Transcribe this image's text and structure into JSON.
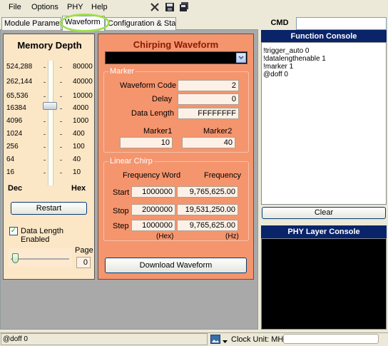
{
  "menu": {
    "items": [
      {
        "label": "File"
      },
      {
        "label": "Options"
      },
      {
        "label": "PHY"
      },
      {
        "label": "Help"
      }
    ],
    "toolbar_icons": [
      "close-icon",
      "save-icon",
      "save-all-icon"
    ]
  },
  "tabs": [
    {
      "label": "Module Parameters",
      "active": false
    },
    {
      "label": "Waveform",
      "active": true
    },
    {
      "label": "Configuration & Status",
      "active": false
    }
  ],
  "memory_depth": {
    "title": "Memory Depth",
    "dec_values": [
      "524,288",
      "262,144",
      "65,536",
      "16384",
      "4096",
      "1024",
      "256",
      "64",
      "16"
    ],
    "hex_values": [
      "80000",
      "40000",
      "10000",
      "4000",
      "1000",
      "400",
      "100",
      "40",
      "10"
    ],
    "dec_label": "Dec",
    "hex_label": "Hex",
    "slider_selected": "16384",
    "restart_label": "Restart",
    "data_length_enabled_label": "Data Length Enabled",
    "data_length_enabled": true,
    "page_label": "Page",
    "page_value": "0"
  },
  "chirp": {
    "title": "Chirping Waveform",
    "dropdown_value": "",
    "marker": {
      "group_title": "Marker",
      "waveform_code_label": "Waveform Code",
      "waveform_code": "2",
      "delay_label": "Delay",
      "delay": "0",
      "data_length_label": "Data Length",
      "data_length": "FFFFFFFF",
      "marker1_label": "Marker1",
      "marker1": "10",
      "marker2_label": "Marker2",
      "marker2": "40"
    },
    "linear": {
      "group_title": "Linear Chirp",
      "freq_word_header": "Frequency Word",
      "freq_header": "Frequency",
      "start_label": "Start",
      "start_word": "1000000",
      "start_freq": "9,765,625.00",
      "stop_label": "Stop",
      "stop_word": "2000000",
      "stop_freq": "19,531,250.00",
      "step_label": "Step",
      "step_word": "1000000",
      "step_freq": "9,765,625.00",
      "hex_unit": "(Hex)",
      "hz_unit": "(Hz)"
    },
    "download_label": "Download Waveform"
  },
  "right": {
    "cmd_label": "CMD",
    "cmd_value": "",
    "function_console_title": "Function Console",
    "function_console_lines": [
      "!trigger_auto 0",
      "!datalengthenable 1",
      "!marker 1",
      "@doff 0"
    ],
    "clear_label": "Clear",
    "phy_console_title": "PHY Layer Console"
  },
  "status": {
    "text": "@doff 0",
    "clock_unit": "Clock Unit: MHz"
  }
}
